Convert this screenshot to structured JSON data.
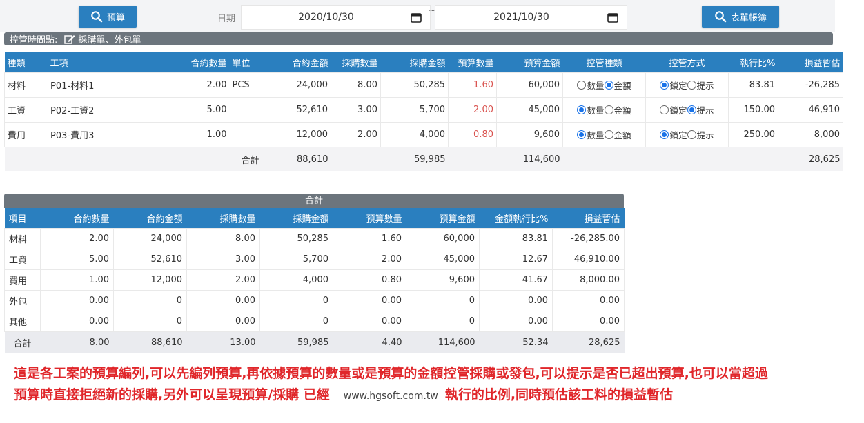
{
  "toolbar": {
    "budget_label": "預算",
    "date_label": "日期",
    "date_start": "2020/10/30",
    "date_sep": "~",
    "date_end": "2021/10/30",
    "report_label": "表單帳簿",
    "accent": "#2a7fbf"
  },
  "control_point": {
    "label": "控管時間點:",
    "value": "採購單、外包單"
  },
  "main_table": {
    "headers": [
      "種類",
      "工項",
      "合約數量",
      "單位",
      "合約金額",
      "採購數量",
      "採購金額",
      "預算數量",
      "預算金額",
      "控管種類",
      "控管方式",
      "執行比%",
      "損益暫估"
    ],
    "option_qty": "數量",
    "option_amt": "金額",
    "option_lock": "鎖定",
    "option_hint": "提示",
    "rows": [
      {
        "type": "材料",
        "item": "P01-材料1",
        "cqty": "2.00",
        "unit": "PCS",
        "camt": "24,000",
        "pqty": "8.00",
        "pamt": "50,285",
        "bqty": "1.60",
        "bamt": "60,000",
        "ctrl": "amt",
        "mode": "lock",
        "ratio": "83.81",
        "pl": "-26,285"
      },
      {
        "type": "工資",
        "item": "P02-工資2",
        "cqty": "5.00",
        "unit": "",
        "camt": "52,610",
        "pqty": "3.00",
        "pamt": "5,700",
        "bqty": "2.00",
        "bamt": "45,000",
        "ctrl": "qty",
        "mode": "hint",
        "ratio": "150.00",
        "pl": "46,910"
      },
      {
        "type": "費用",
        "item": "P03-費用3",
        "cqty": "1.00",
        "unit": "",
        "camt": "12,000",
        "pqty": "2.00",
        "pamt": "4,000",
        "bqty": "0.80",
        "bamt": "9,600",
        "ctrl": "qty",
        "mode": "lock",
        "ratio": "250.00",
        "pl": "8,000"
      }
    ],
    "total": {
      "label": "合計",
      "camt": "88,610",
      "pamt": "59,985",
      "bamt": "114,600",
      "pl": "28,625"
    }
  },
  "summary_table": {
    "title": "合計",
    "headers": [
      "項目",
      "合約數量",
      "合約金額",
      "採購數量",
      "採購金額",
      "預算數量",
      "預算金額",
      "金額執行比%",
      "損益暫估"
    ],
    "rows": [
      [
        "材料",
        "2.00",
        "24,000",
        "8.00",
        "50,285",
        "1.60",
        "60,000",
        "83.81",
        "-26,285.00"
      ],
      [
        "工資",
        "5.00",
        "52,610",
        "3.00",
        "5,700",
        "2.00",
        "45,000",
        "12.67",
        "46,910.00"
      ],
      [
        "費用",
        "1.00",
        "12,000",
        "2.00",
        "4,000",
        "0.80",
        "9,600",
        "41.67",
        "8,000.00"
      ],
      [
        "外包",
        "0.00",
        "0",
        "0.00",
        "0",
        "0.00",
        "0",
        "0.00",
        "0.00"
      ],
      [
        "其他",
        "0.00",
        "0",
        "0.00",
        "0",
        "0.00",
        "0",
        "0.00",
        "0.00"
      ]
    ],
    "total": [
      "合計",
      "8.00",
      "88,610",
      "13.00",
      "59,985",
      "4.40",
      "114,600",
      "52.34",
      "28,625"
    ]
  },
  "note": {
    "line1": "這是各工案的預算編列,可以先編列預算,再依據預算的數量或是預算的金額控管採購或發包,可以提示是否已超出預算,也可以當超過",
    "line2a": "預算時直接拒絕新的採購,另外可以呈現預算/採購 已經",
    "site": "www.hgsoft.com.tw",
    "line2b": "執行的比例,同時預估該工料的損益暫估",
    "color": "#e0262a"
  }
}
